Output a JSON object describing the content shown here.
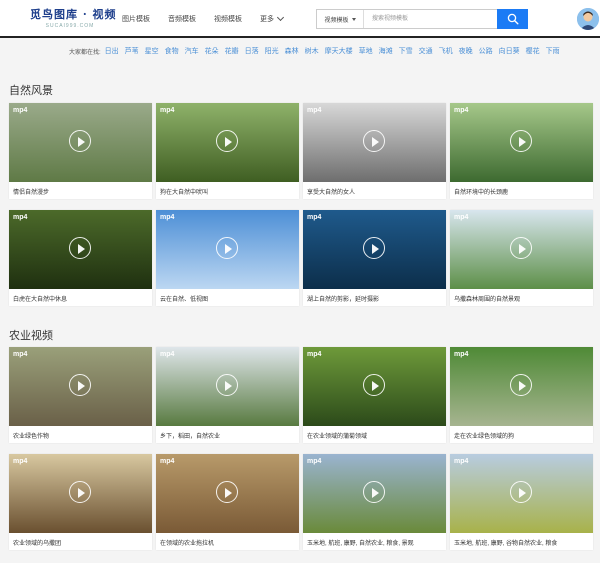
{
  "header": {
    "logo_main": "觅鸟图库 · 视频",
    "logo_sub": "SUCAI999.COM",
    "nav": [
      "图片模板",
      "音频模板",
      "视频模板"
    ],
    "nav_more": "更多",
    "search_type": "视频模板",
    "search_placeholder": "搜索视频模板"
  },
  "tags": {
    "label": "大家都在找:",
    "items": [
      "日出",
      "芦苇",
      "星空",
      "食物",
      "汽车",
      "花朵",
      "花瓣",
      "日落",
      "阳光",
      "森林",
      "树木",
      "摩天大楼",
      "草地",
      "海滩",
      "下雪",
      "交通",
      "飞机",
      "夜晚",
      "公路",
      "向日葵",
      "樱花",
      "下雨"
    ]
  },
  "sections": [
    {
      "title": "自然风景",
      "cards": [
        {
          "badge": "mp4",
          "caption": "情侣自然漫步",
          "colors": [
            "#9aaa8a",
            "#5f7a46"
          ]
        },
        {
          "badge": "mp4",
          "caption": "狗在大自然中吠叫",
          "colors": [
            "#8fb26a",
            "#3f5e22"
          ]
        },
        {
          "badge": "mp4",
          "caption": "享受大自然的女人",
          "colors": [
            "#d8d8d8",
            "#6e6e6e"
          ]
        },
        {
          "badge": "mp4",
          "caption": "自然环境中的长颈鹿",
          "colors": [
            "#a6c88a",
            "#3d6a30"
          ]
        },
        {
          "badge": "mp4",
          "caption": "白虎在大自然中休息",
          "colors": [
            "#4c6a2a",
            "#1f3010"
          ]
        },
        {
          "badge": "mp4",
          "caption": "云在自然、低视图",
          "colors": [
            "#4d8fd6",
            "#bcd7f2"
          ]
        },
        {
          "badge": "mp4",
          "caption": "湖上自然的剪影，延时摄影",
          "colors": [
            "#1f5a8c",
            "#0c2e4a"
          ]
        },
        {
          "badge": "mp4",
          "caption": "乌撒森林周围的自然景观",
          "colors": [
            "#d8e6ee",
            "#5d8f48"
          ]
        }
      ]
    },
    {
      "title": "农业视频",
      "cards": [
        {
          "badge": "mp4",
          "caption": "农业绿色作物",
          "colors": [
            "#9aa07a",
            "#6a6048"
          ]
        },
        {
          "badge": "mp4",
          "caption": "乡下，稻田，自然农业",
          "colors": [
            "#dfe6ea",
            "#587a40"
          ]
        },
        {
          "badge": "mp4",
          "caption": "在农业领域的蒲菊领域",
          "colors": [
            "#6e9a3a",
            "#2c4a1a"
          ]
        },
        {
          "badge": "mp4",
          "caption": "走在农业绿色领域的狗",
          "colors": [
            "#4f8a36",
            "#a6b490"
          ]
        },
        {
          "badge": "mp4",
          "caption": "农业领域的乌撒团",
          "colors": [
            "#d8c8a0",
            "#6a5030"
          ]
        },
        {
          "badge": "mp4",
          "caption": "在领域的农业拖拉机",
          "colors": [
            "#b89a6a",
            "#7a5a36"
          ]
        },
        {
          "badge": "mp4",
          "caption": "玉米地, 航班, 康野, 自然农业, 粮食, 景观",
          "colors": [
            "#9ab4d0",
            "#6a8a3a"
          ]
        },
        {
          "badge": "mp4",
          "caption": "玉米地, 航班, 康野, 谷物自然农业, 粮食",
          "colors": [
            "#b8cce0",
            "#a8b24a"
          ]
        }
      ]
    }
  ]
}
